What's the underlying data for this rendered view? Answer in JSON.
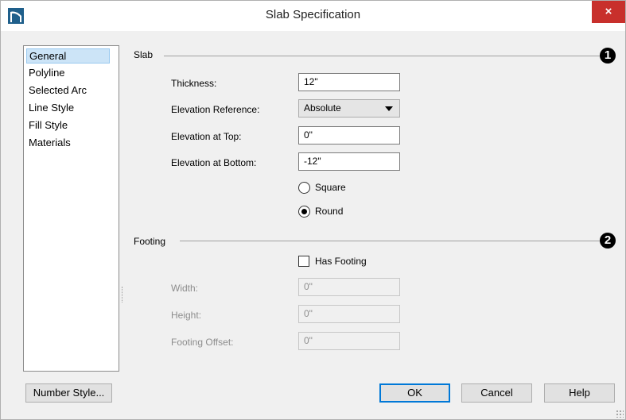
{
  "window": {
    "title": "Slab Specification",
    "close_symbol": "×"
  },
  "sidebar": {
    "items": [
      {
        "label": "General",
        "selected": true
      },
      {
        "label": "Polyline"
      },
      {
        "label": "Selected Arc"
      },
      {
        "label": "Line Style"
      },
      {
        "label": "Fill Style"
      },
      {
        "label": "Materials"
      }
    ]
  },
  "slab": {
    "heading": "Slab",
    "marker": "1",
    "thickness_label": "Thickness:",
    "thickness_value": "12\"",
    "elevation_reference_label": "Elevation Reference:",
    "elevation_reference_value": "Absolute",
    "elevation_top_label": "Elevation at Top:",
    "elevation_top_value": "0\"",
    "elevation_bottom_label": "Elevation at Bottom:",
    "elevation_bottom_value": "-12\"",
    "square_label": "Square",
    "round_label": "Round",
    "shape_selected": "Round"
  },
  "footing": {
    "heading": "Footing",
    "marker": "2",
    "has_footing_label": "Has Footing",
    "has_footing_checked": false,
    "width_label": "Width:",
    "width_value": "0\"",
    "height_label": "Height:",
    "height_value": "0\"",
    "offset_label": "Footing Offset:",
    "offset_value": "0\""
  },
  "buttons": {
    "number_style": "Number Style...",
    "ok": "OK",
    "cancel": "Cancel",
    "help": "Help"
  },
  "colors": {
    "close_button": "#c8302c",
    "selection": "#cce4f7",
    "default_button_border": "#0078d7"
  }
}
